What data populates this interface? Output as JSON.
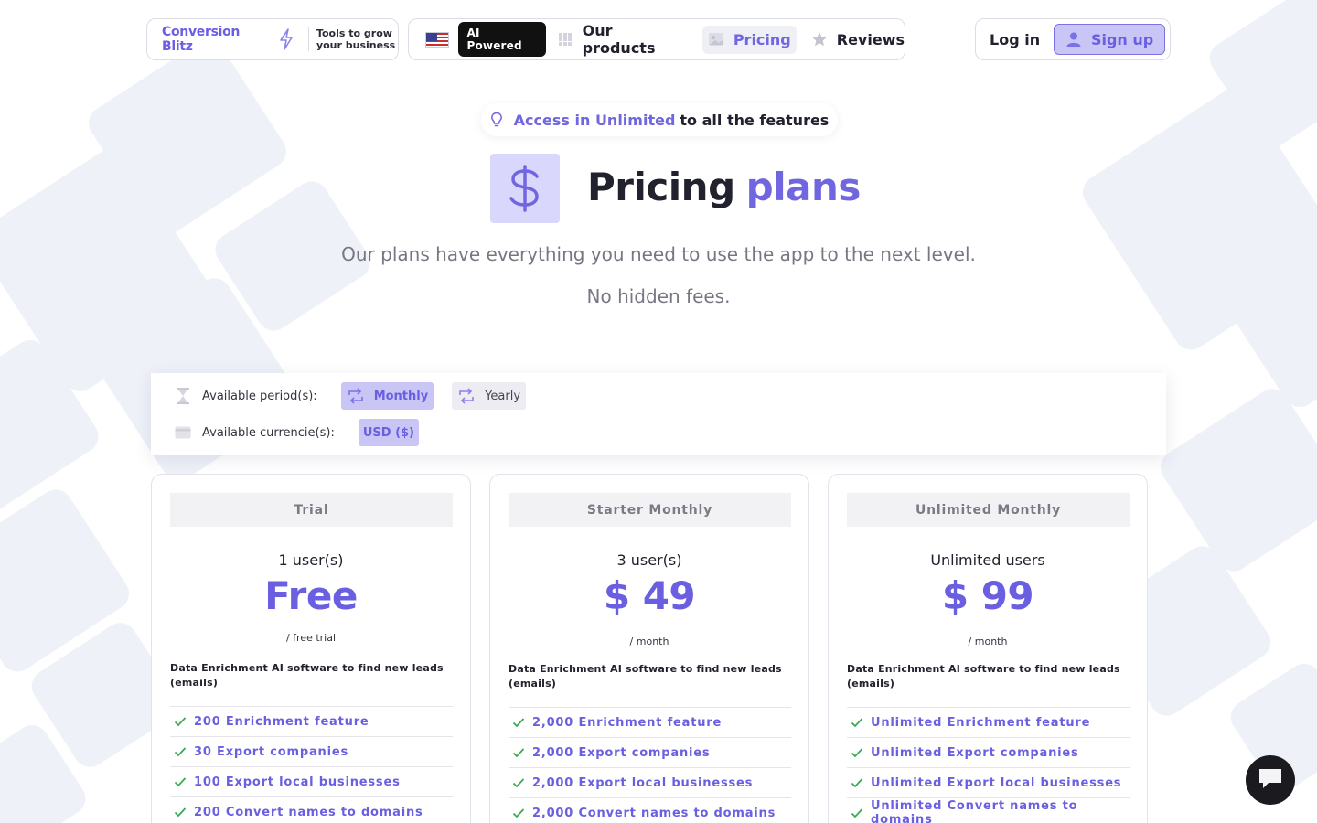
{
  "brand": {
    "name": "Conversion Blitz",
    "tagline": "Tools to grow your business"
  },
  "nav": {
    "ai_badge": "AI Powered",
    "products": "Our products",
    "pricing": "Pricing",
    "reviews": "Reviews"
  },
  "auth": {
    "login": "Log in",
    "signup": "Sign up"
  },
  "hero": {
    "announce_highlight": "Access in Unlimited",
    "announce_rest": "to all the features",
    "title_part1": "Pricing",
    "title_part2": "plans",
    "subtitle": "Our plans have everything you need to use the app to the next level.",
    "subtitle2": "No hidden fees."
  },
  "options": {
    "period_label": "Available period(s):",
    "monthly": "Monthly",
    "yearly": "Yearly",
    "currency_label": "Available currencie(s):",
    "usd": "USD ($)",
    "selected_period": "Monthly",
    "selected_currency": "USD ($)"
  },
  "plans": [
    {
      "name": "Trial",
      "users": "1 user(s)",
      "price": "Free",
      "period": "/ free trial",
      "description": "Data Enrichment AI software to find new leads (emails)",
      "features": [
        "200 Enrichment feature",
        "30 Export companies",
        "100 Export local businesses",
        "200 Convert names to domains"
      ]
    },
    {
      "name": "Starter Monthly",
      "users": "3 user(s)",
      "price": "$ 49",
      "period": "/ month",
      "description": "Data Enrichment AI software to find new leads (emails)",
      "features": [
        "2,000 Enrichment feature",
        "2,000 Export companies",
        "2,000 Export local businesses",
        "2,000 Convert names to domains"
      ]
    },
    {
      "name": "Unlimited Monthly",
      "users": "Unlimited users",
      "price": "$ 99",
      "period": "/ month",
      "description": "Data Enrichment AI software to find new leads (emails)",
      "features": [
        "Unlimited Enrichment feature",
        "Unlimited Export companies",
        "Unlimited Export local businesses",
        "Unlimited Convert names to domains"
      ]
    }
  ],
  "icons": {
    "brand": "lightning-bolt-icon",
    "flag": "us-flag-icon",
    "products": "grid-icon",
    "pricing": "pricing-image-icon",
    "reviews": "star-icon",
    "signup": "user-icon",
    "announce": "lightbulb-icon",
    "hero": "dollar-icon",
    "period": "hourglass-icon",
    "currency": "card-icon",
    "cycle": "repeat-icon",
    "feature": "check-icon",
    "chat": "chat-icon"
  },
  "colors": {
    "accent": "#7066e0",
    "accent_light": "#c9c6f5",
    "text": "#22222e",
    "muted": "#777783"
  }
}
